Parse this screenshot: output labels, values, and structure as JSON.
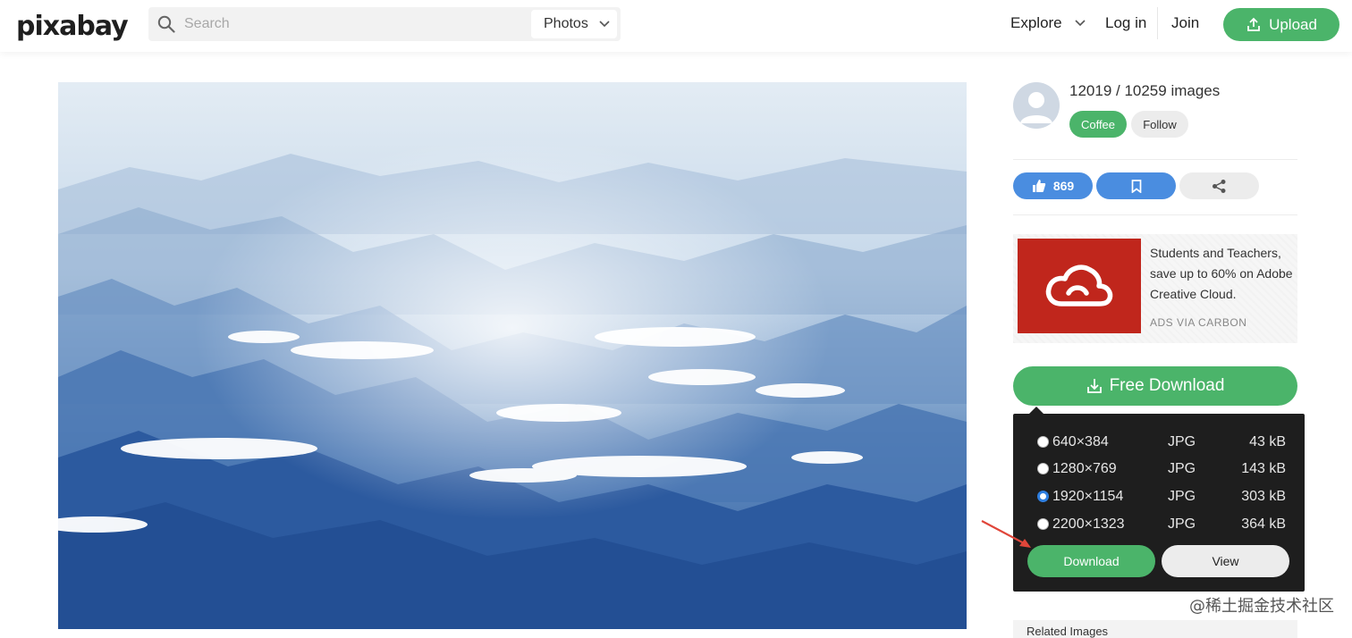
{
  "header": {
    "logo_text": "pixabay",
    "search_placeholder": "Search",
    "type_select_value": "Photos",
    "nav_explore": "Explore",
    "nav_login": "Log in",
    "nav_join": "Join",
    "upload_label": "Upload",
    "accent_color": "#4bb46a"
  },
  "photo": {
    "alt": "Mountain ridges above a sea of clouds"
  },
  "profile": {
    "counts": "12019 / 10259 images",
    "coffee_label": "Coffee",
    "follow_label": "Follow"
  },
  "actions": {
    "like_count": "869",
    "like_icon": "thumbs-up-icon",
    "save_icon": "bookmark-icon",
    "share_icon": "share-icon"
  },
  "ad": {
    "text": "Students and Teachers, save up to 60% on Adobe Creative Cloud.",
    "via": "ADS VIA CARBON"
  },
  "download": {
    "free_download_label": "Free Download",
    "options": [
      {
        "resolution": "640×384",
        "format": "JPG",
        "size": "43 kB",
        "selected": false
      },
      {
        "resolution": "1280×769",
        "format": "JPG",
        "size": "143 kB",
        "selected": false
      },
      {
        "resolution": "1920×1154",
        "format": "JPG",
        "size": "303 kB",
        "selected": true
      },
      {
        "resolution": "2200×1323",
        "format": "JPG",
        "size": "364 kB",
        "selected": false
      }
    ],
    "download_label": "Download",
    "view_label": "View"
  },
  "related": {
    "label": "Related Images"
  },
  "watermark": "@稀土掘金技术社区"
}
